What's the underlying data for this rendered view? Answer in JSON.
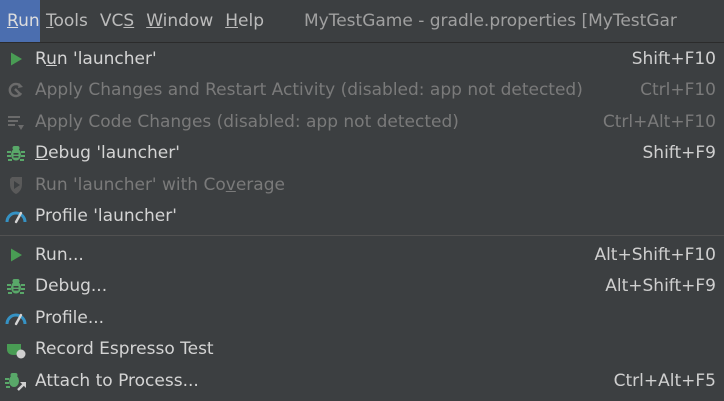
{
  "menubar": {
    "items": [
      {
        "label": "Run",
        "mnemonic_index": 0
      },
      {
        "label": "Tools",
        "mnemonic_index": 0
      },
      {
        "label": "VCS",
        "mnemonic_index": 2
      },
      {
        "label": "Window",
        "mnemonic_index": 0
      },
      {
        "label": "Help",
        "mnemonic_index": 0
      }
    ],
    "window_title": "MyTestGame - gradle.properties [MyTestGar"
  },
  "run_menu": {
    "group1": [
      {
        "pre": "R",
        "mn": "u",
        "post": "n 'launcher'",
        "shortcut": "Shift+F10",
        "disabled": false,
        "icon": "run-icon"
      },
      {
        "pre": "",
        "mn": "",
        "post": "Apply Changes and Restart Activity (disabled: app not detected)",
        "shortcut": "Ctrl+F10",
        "disabled": true,
        "icon": "apply-changes-restart-icon"
      },
      {
        "pre": "",
        "mn": "",
        "post": "Apply Code Changes (disabled: app not detected)",
        "shortcut": "Ctrl+Alt+F10",
        "disabled": true,
        "icon": "apply-code-changes-icon"
      },
      {
        "pre": "",
        "mn": "D",
        "post": "ebug 'launcher'",
        "shortcut": "Shift+F9",
        "disabled": false,
        "icon": "debug-icon"
      },
      {
        "pre": "Run 'launcher' with Co",
        "mn": "v",
        "post": "erage",
        "shortcut": "",
        "disabled": true,
        "icon": "coverage-icon"
      },
      {
        "pre": "",
        "mn": "",
        "post": "Profile 'launcher'",
        "shortcut": "",
        "disabled": false,
        "icon": "profile-icon"
      }
    ],
    "group2": [
      {
        "pre": "",
        "mn": "",
        "post": "Run...",
        "shortcut": "Alt+Shift+F10",
        "disabled": false,
        "icon": "run-icon"
      },
      {
        "pre": "",
        "mn": "",
        "post": "Debug...",
        "shortcut": "Alt+Shift+F9",
        "disabled": false,
        "icon": "debug-icon"
      },
      {
        "pre": "",
        "mn": "",
        "post": "Profile...",
        "shortcut": "",
        "disabled": false,
        "icon": "profile-icon"
      },
      {
        "pre": "",
        "mn": "",
        "post": "Record Espresso Test",
        "shortcut": "",
        "disabled": false,
        "icon": "record-espresso-icon"
      },
      {
        "pre": "",
        "mn": "",
        "post": "Attach to Process...",
        "shortcut": "Ctrl+Alt+F5",
        "disabled": false,
        "icon": "attach-process-icon"
      }
    ]
  },
  "colors": {
    "background": "#3c3f41",
    "accent": "#4b6eaf",
    "run_green": "#499c54",
    "debug_green": "#59a869",
    "profile_blue": "#3592c4",
    "disabled_text": "#7a7a7a"
  }
}
